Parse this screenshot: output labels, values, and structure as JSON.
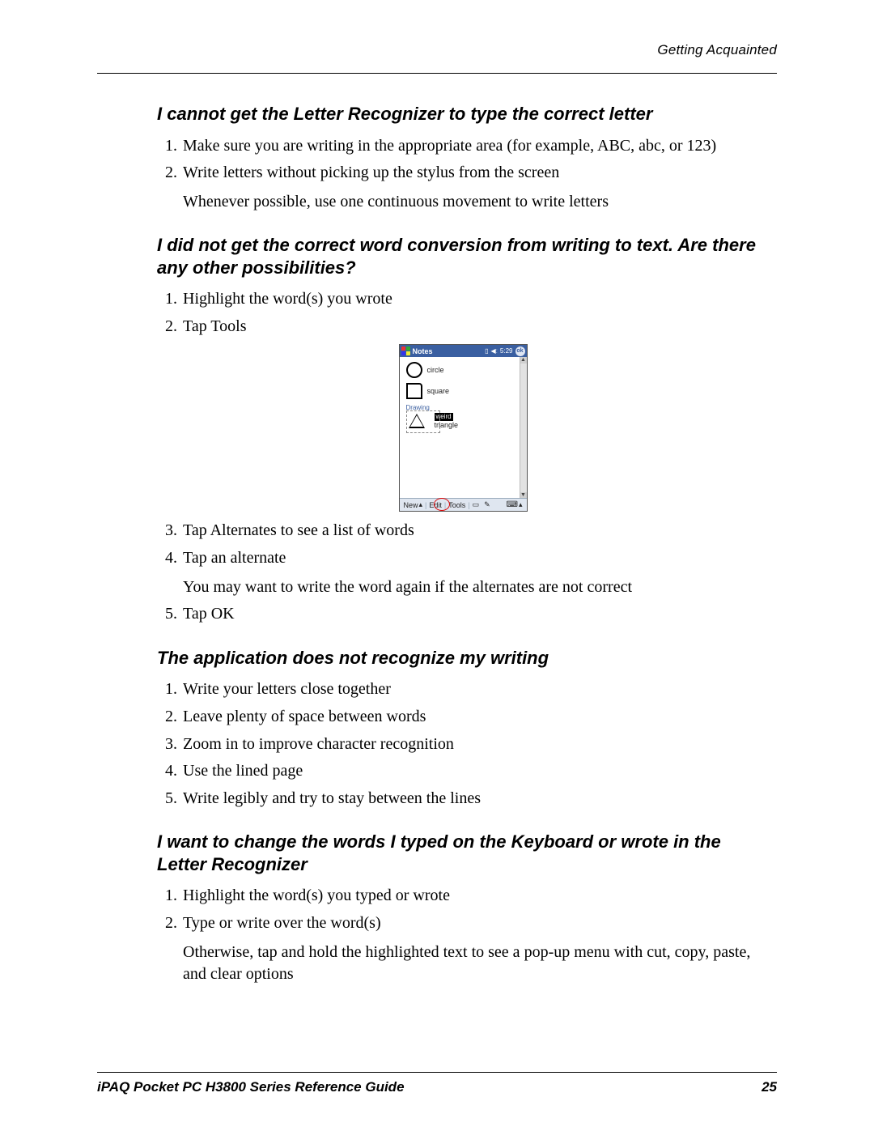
{
  "header": {
    "chapter": "Getting Acquainted"
  },
  "sections": {
    "s1": {
      "title": "I cannot get the Letter Recognizer to type the correct letter",
      "items": [
        "Make sure you are writing in the appropriate area (for example, ABC, abc, or 123)",
        "Write letters without picking up the stylus from the screen"
      ],
      "sub2": "Whenever possible, use one continuous movement to write letters"
    },
    "s2": {
      "title": "I did not get the correct word conversion from writing to text. Are there any other possibilities?",
      "items_a": [
        "Highlight the word(s) you wrote",
        "Tap Tools"
      ],
      "items_b": [
        "Tap Alternates to see a list of words",
        "Tap an alternate"
      ],
      "sub4": "You may want to write the word again if the alternates are not correct",
      "items_c": [
        "Tap OK"
      ]
    },
    "s3": {
      "title": "The application does not recognize my writing",
      "items": [
        "Write your letters close together",
        "Leave plenty of space between words",
        "Zoom in to improve character recognition",
        "Use the lined page",
        "Write legibly and try to stay between the lines"
      ]
    },
    "s4": {
      "title": "I want to change the words I typed on the Keyboard or wrote in the Letter Recognizer",
      "items": [
        "Highlight the word(s) you typed or wrote",
        "Type or write over the word(s)"
      ],
      "sub2": "Otherwise, tap and hold the highlighted text to see a pop-up menu with cut, copy, paste, and clear options"
    }
  },
  "device": {
    "app": "Notes",
    "time": "5:29",
    "ok": "ok",
    "circle": "circle",
    "square": "square",
    "drawing": "Drawing",
    "weird": "weird",
    "triangle": "triangle",
    "menu_new": "New",
    "menu_edit": "Edit",
    "menu_tools": "Tools"
  },
  "footer": {
    "left": "iPAQ Pocket PC H3800 Series Reference Guide",
    "right": "25"
  }
}
